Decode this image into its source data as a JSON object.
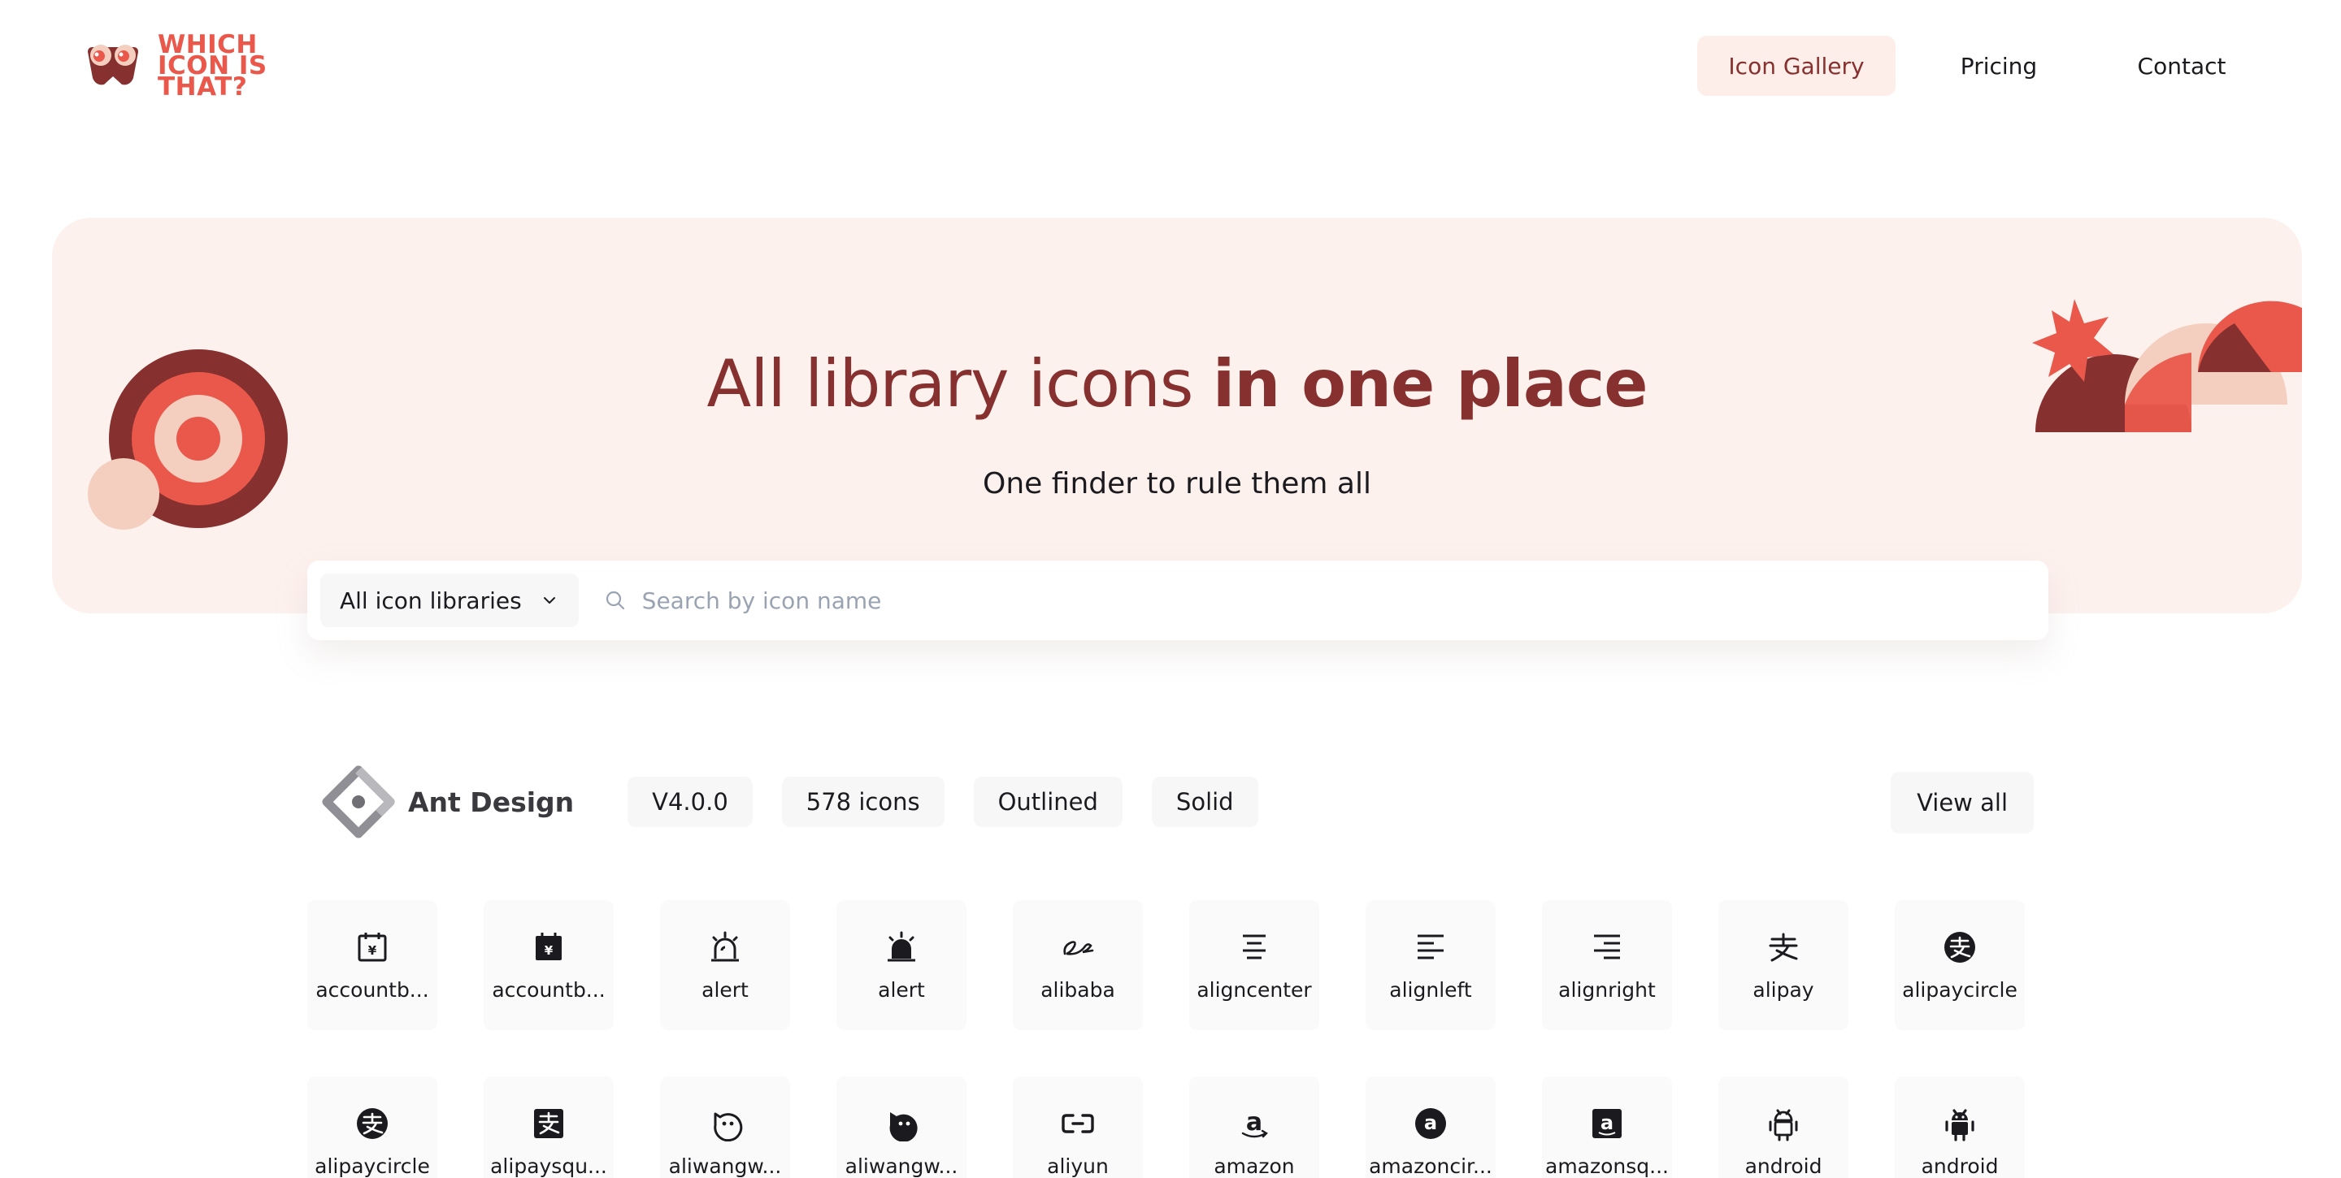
{
  "brand": {
    "logo_text": "WHICH\nICON IS\nTHAT?",
    "accent": "#e9584b",
    "dark": "#86312f",
    "peach": "#f4cfc0"
  },
  "nav": {
    "items": [
      {
        "label": "Icon Gallery",
        "active": true
      },
      {
        "label": "Pricing",
        "active": false
      },
      {
        "label": "Contact",
        "active": false
      }
    ]
  },
  "hero": {
    "title_light": "All library icons ",
    "title_bold": "in one place",
    "subtitle": "One finder to rule them all"
  },
  "search": {
    "library_select": "All icon libraries",
    "placeholder": "Search by icon name"
  },
  "library": {
    "name": "Ant Design",
    "version": "V4.0.0",
    "count": "578 icons",
    "styles": [
      "Outlined",
      "Solid"
    ],
    "view_all": "View all"
  },
  "icons": [
    {
      "label": "accountb...",
      "icon": "account-book-outlined-icon"
    },
    {
      "label": "accountb...",
      "icon": "account-book-filled-icon"
    },
    {
      "label": "alert",
      "icon": "alert-outlined-icon"
    },
    {
      "label": "alert",
      "icon": "alert-filled-icon"
    },
    {
      "label": "alibaba",
      "icon": "alibaba-icon"
    },
    {
      "label": "aligncenter",
      "icon": "align-center-icon"
    },
    {
      "label": "alignleft",
      "icon": "align-left-icon"
    },
    {
      "label": "alignright",
      "icon": "align-right-icon"
    },
    {
      "label": "alipay",
      "icon": "alipay-icon"
    },
    {
      "label": "alipaycircle",
      "icon": "alipay-circle-icon"
    },
    {
      "label": "alipaycircle",
      "icon": "alipay-circle-filled-icon"
    },
    {
      "label": "alipaysqu...",
      "icon": "alipay-square-icon"
    },
    {
      "label": "aliwangw...",
      "icon": "aliwangwang-outlined-icon"
    },
    {
      "label": "aliwangw...",
      "icon": "aliwangwang-filled-icon"
    },
    {
      "label": "aliyun",
      "icon": "aliyun-icon"
    },
    {
      "label": "amazon",
      "icon": "amazon-icon"
    },
    {
      "label": "amazoncir...",
      "icon": "amazon-circle-icon"
    },
    {
      "label": "amazonsq...",
      "icon": "amazon-square-icon"
    },
    {
      "label": "android",
      "icon": "android-outlined-icon"
    },
    {
      "label": "android",
      "icon": "android-filled-icon"
    }
  ]
}
